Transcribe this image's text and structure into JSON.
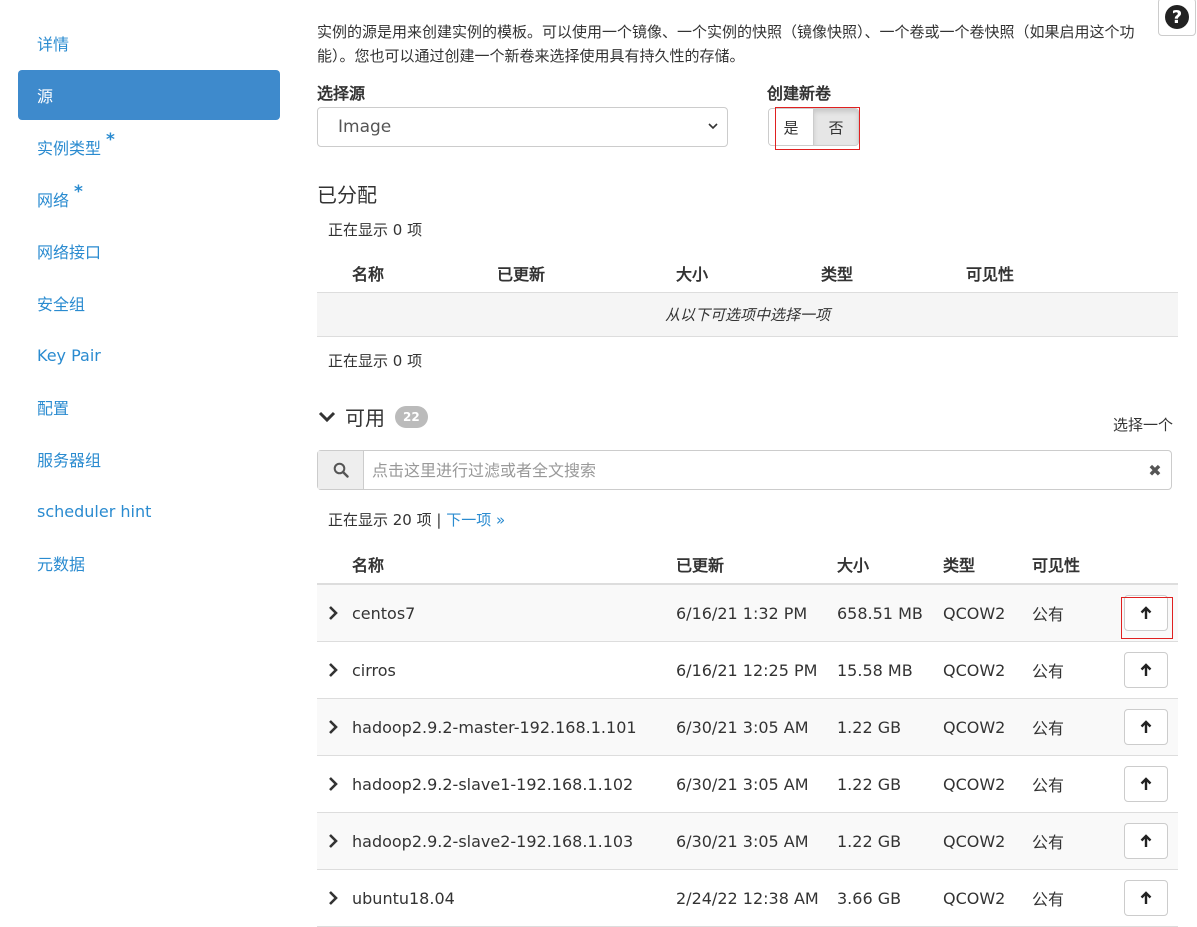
{
  "sidebar": {
    "items": [
      {
        "label": "详情",
        "required": ""
      },
      {
        "label": "源",
        "required": ""
      },
      {
        "label": "实例类型",
        "required": "*"
      },
      {
        "label": "网络",
        "required": "*"
      },
      {
        "label": "网络接口",
        "required": ""
      },
      {
        "label": "安全组",
        "required": ""
      },
      {
        "label": "Key Pair",
        "required": ""
      },
      {
        "label": "配置",
        "required": ""
      },
      {
        "label": "服务器组",
        "required": ""
      },
      {
        "label": "scheduler hint",
        "required": ""
      },
      {
        "label": "元数据",
        "required": ""
      }
    ],
    "active_index": 1
  },
  "help": {
    "icon": "question-circle-icon",
    "label": "?"
  },
  "description": "实例的源是用来创建实例的模板。可以使用一个镜像、一个实例的快照（镜像快照）、一个卷或一个卷快照（如果启用这个功能）。您也可以通过创建一个新卷来选择使用具有持久性的存储。",
  "source": {
    "label": "选择源",
    "selected": "Image"
  },
  "new_volume": {
    "label": "创建新卷",
    "yes": "是",
    "no": "否",
    "selected": "否"
  },
  "allocated": {
    "title": "已分配",
    "showing_top": "正在显示 0 项",
    "showing_bottom": "正在显示 0 项",
    "columns": [
      "名称",
      "已更新",
      "大小",
      "类型",
      "可见性"
    ],
    "empty_message": "从以下可选项中选择一项"
  },
  "available": {
    "title": "可用",
    "count": "22",
    "choose_hint": "选择一个",
    "search_placeholder": "点击这里进行过滤或者全文搜索",
    "showing": "正在显示 20 项 | ",
    "next_link": "下一项 »",
    "columns": [
      "名称",
      "已更新",
      "大小",
      "类型",
      "可见性"
    ],
    "rows": [
      {
        "name": "centos7",
        "updated": "6/16/21 1:32 PM",
        "size": "658.51 MB",
        "type": "QCOW2",
        "visibility": "公有"
      },
      {
        "name": "cirros",
        "updated": "6/16/21 12:25 PM",
        "size": "15.58 MB",
        "type": "QCOW2",
        "visibility": "公有"
      },
      {
        "name": "hadoop2.9.2-master-192.168.1.101",
        "updated": "6/30/21 3:05 AM",
        "size": "1.22 GB",
        "type": "QCOW2",
        "visibility": "公有"
      },
      {
        "name": "hadoop2.9.2-slave1-192.168.1.102",
        "updated": "6/30/21 3:05 AM",
        "size": "1.22 GB",
        "type": "QCOW2",
        "visibility": "公有"
      },
      {
        "name": "hadoop2.9.2-slave2-192.168.1.103",
        "updated": "6/30/21 3:05 AM",
        "size": "1.22 GB",
        "type": "QCOW2",
        "visibility": "公有"
      },
      {
        "name": "ubuntu18.04",
        "updated": "2/24/22 12:38 AM",
        "size": "3.66 GB",
        "type": "QCOW2",
        "visibility": "公有"
      }
    ]
  },
  "colors": {
    "accent": "#3e8acc",
    "link": "#2a8bd0",
    "highlight_box": "#e02020"
  }
}
